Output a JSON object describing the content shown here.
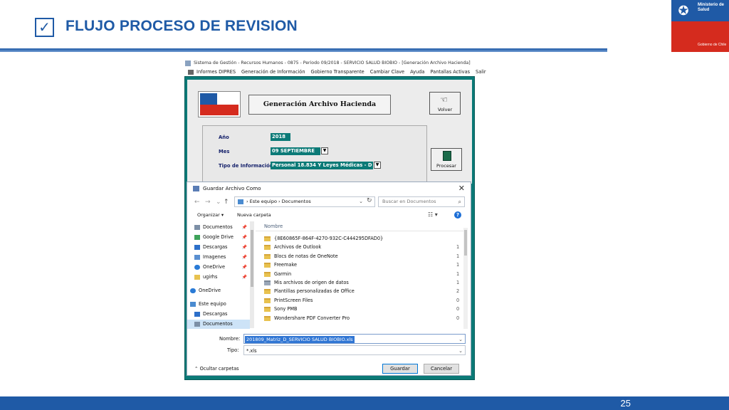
{
  "slide": {
    "title": "FLUJO PROCESO DE REVISION",
    "page_number": "25",
    "logo_line1": "Ministerio de Salud",
    "logo_line2": "Gobierno de Chile",
    "colors": {
      "accent": "#1f5aa6",
      "red": "#d52b1e",
      "teal": "#0b7a77"
    }
  },
  "app": {
    "window_title": "Sistema de Gestión - Recursos Humanos - 0875 - Periodo 09/2018 - SERVICIO SALUD BIOBIO - [Generación Archivo Hacienda]",
    "menu": [
      "Informes DIPRES",
      "Generación de Información",
      "Gobierno Transparente",
      "Cambiar Clave",
      "Ayuda",
      "Pantallas Activas",
      "Salir"
    ],
    "form_title": "Generación Archivo Hacienda",
    "volver_label": "Volver",
    "procesar_label": "Procesar",
    "year_label": "Año",
    "year_value": "2018",
    "month_label": "Mes",
    "month_value": "09 SEPTIEMBRE",
    "info_label": "Tipo de Información",
    "info_value": "Personal 18.834 Y Leyes Médicas - D"
  },
  "dialog": {
    "title": "Guardar Archivo Como",
    "address": [
      "Este equipo",
      "Documentos"
    ],
    "search_placeholder": "Buscar en Documentos",
    "organize": "Organizar",
    "new_folder": "Nueva carpeta",
    "nav": [
      {
        "label": "Documentos",
        "icon": "documents-icon",
        "pinned": true
      },
      {
        "label": "Google Drive",
        "icon": "google-drive-icon",
        "pinned": true
      },
      {
        "label": "Descargas",
        "icon": "download-icon",
        "pinned": true
      },
      {
        "label": "Imagenes",
        "icon": "images-icon",
        "pinned": true
      },
      {
        "label": "OneDrive",
        "icon": "onedrive-icon",
        "pinned": true
      },
      {
        "label": "ugirhs",
        "icon": "folder-icon",
        "pinned": true
      },
      {
        "label": "OneDrive",
        "icon": "onedrive-icon",
        "pinned": false
      },
      {
        "label": "Este equipo",
        "icon": "computer-icon",
        "pinned": false
      },
      {
        "label": "Descargas",
        "icon": "download-icon",
        "pinned": false
      },
      {
        "label": "Documentos",
        "icon": "documents-icon",
        "pinned": false
      }
    ],
    "column_name": "Nombre",
    "files": [
      {
        "name": "{8E60865F-864F-4270-932C-C444295DFAD0}",
        "side": ""
      },
      {
        "name": "Archivos de Outlook",
        "side": "1"
      },
      {
        "name": "Blocs de notas de OneNote",
        "side": "1"
      },
      {
        "name": "Freemake",
        "side": "1"
      },
      {
        "name": "Garmin",
        "side": "1"
      },
      {
        "name": "Mis archivos de origen de datos",
        "side": "1"
      },
      {
        "name": "Plantillas personalizadas de Office",
        "side": "2"
      },
      {
        "name": "PrintScreen Files",
        "side": "0"
      },
      {
        "name": "Sony PMB",
        "side": "0"
      },
      {
        "name": "Wondershare PDF Converter Pro",
        "side": "0"
      }
    ],
    "name_label": "Nombre:",
    "name_value": "201809_Matriz_D_SERVICIO SALUD BIOBIO.xls",
    "type_label": "Tipo:",
    "type_value": "*.xls",
    "hide_folders": "Ocultar carpetas",
    "save_label": "Guardar",
    "cancel_label": "Cancelar"
  }
}
